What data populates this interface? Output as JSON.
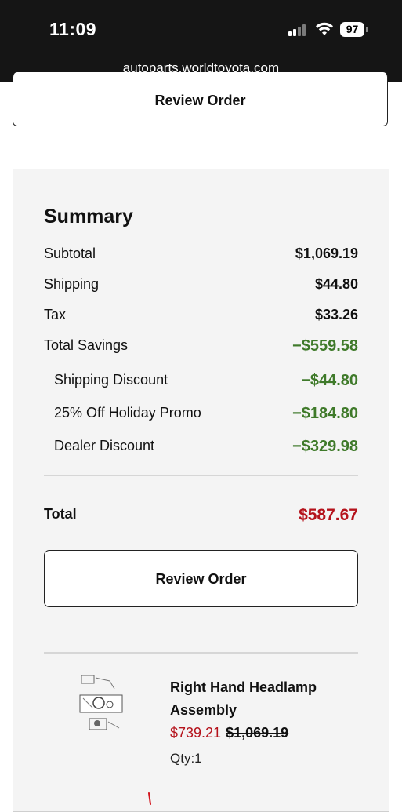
{
  "status_bar": {
    "time": "11:09",
    "battery": "97",
    "icons": [
      "signal-icon",
      "wifi-icon",
      "battery-icon"
    ]
  },
  "browser": {
    "url": "autoparts.worldtoyota.com"
  },
  "top_button": {
    "label": "Review Order"
  },
  "summary": {
    "title": "Summary",
    "rows": [
      {
        "label": "Subtotal",
        "value": "$1,069.19"
      },
      {
        "label": "Shipping",
        "value": "$44.80"
      },
      {
        "label": "Tax",
        "value": "$33.26"
      },
      {
        "label": "Total Savings",
        "value": "−$559.58"
      },
      {
        "label": "Shipping Discount",
        "value": "−$44.80"
      },
      {
        "label": "25% Off Holiday Promo",
        "value": "−$184.80"
      },
      {
        "label": "Dealer Discount",
        "value": "−$329.98"
      }
    ],
    "total_label": "Total",
    "total_value": "$587.67",
    "review_button": "Review Order"
  },
  "item": {
    "name": "Right Hand Headlamp Assembly",
    "sale_price": "$739.21",
    "original_price": "$1,069.19",
    "qty": "Qty:1"
  },
  "colors": {
    "savings_green": "#3f7a2a",
    "total_red": "#b5121b",
    "status_bar_bg": "#151515",
    "panel_bg": "#f4f4f4"
  }
}
